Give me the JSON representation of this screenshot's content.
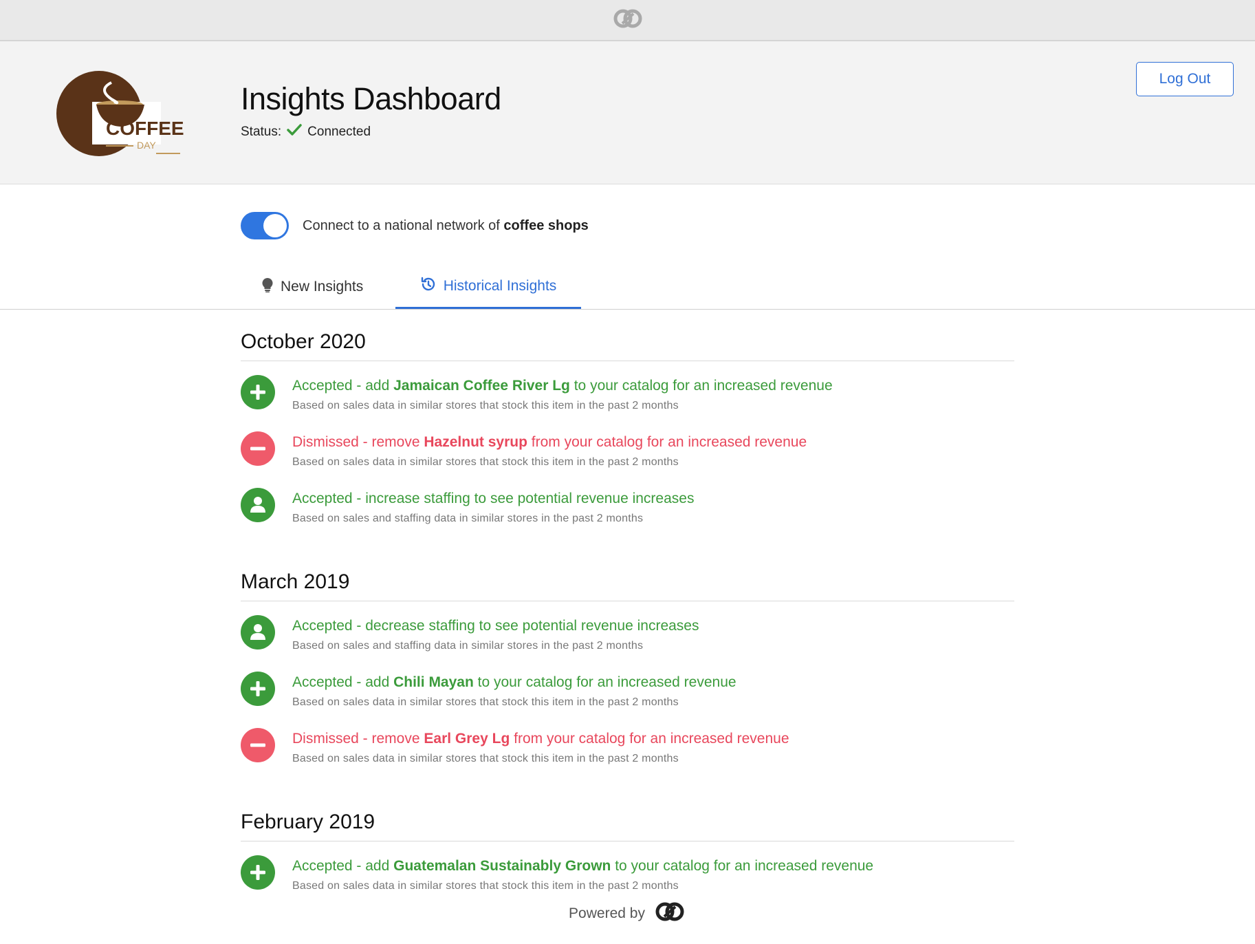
{
  "colors": {
    "accent": "#2f6fd6",
    "accepted": "#3b9b3b",
    "dismissed": "#e8475c"
  },
  "logo": {
    "line1": "COFFEE",
    "line2": "DAY"
  },
  "header": {
    "title": "Insights Dashboard",
    "status_label": "Status:",
    "status_value": "Connected",
    "logout_label": "Log Out"
  },
  "toggle": {
    "label_prefix": "Connect to a national network of",
    "label_bold": "coffee shops",
    "state": "on"
  },
  "tabs": {
    "new": "New Insights",
    "historical": "Historical Insights"
  },
  "sections": [
    {
      "month": "October 2020",
      "items": [
        {
          "status": "accepted",
          "icon": "plus-icon",
          "prefix": "Accepted - add",
          "bold": "Jamaican Coffee River Lg",
          "suffix": "to your catalog for an increased revenue",
          "sub": "Based on sales data in similar stores that stock this item in the past 2 months"
        },
        {
          "status": "dismissed",
          "icon": "minus-icon",
          "prefix": "Dismissed - remove",
          "bold": "Hazelnut syrup",
          "suffix": "from your catalog for an increased revenue",
          "sub": "Based on sales data in similar stores that stock this item in the past 2 months"
        },
        {
          "status": "accepted",
          "icon": "person-icon",
          "prefix": "Accepted - increase staffing to see potential revenue increases",
          "bold": "",
          "suffix": "",
          "sub": "Based on sales and staffing data in similar stores in the past 2 months"
        }
      ]
    },
    {
      "month": "March 2019",
      "items": [
        {
          "status": "accepted",
          "icon": "person-icon",
          "prefix": "Accepted - decrease staffing to see potential revenue increases",
          "bold": "",
          "suffix": "",
          "sub": "Based on sales and staffing data in similar stores in the past 2 months"
        },
        {
          "status": "accepted",
          "icon": "plus-icon",
          "prefix": "Accepted - add",
          "bold": "Chili Mayan",
          "suffix": "to your catalog for an increased revenue",
          "sub": "Based on sales data in similar stores that stock this item in the past 2 months"
        },
        {
          "status": "dismissed",
          "icon": "minus-icon",
          "prefix": "Dismissed - remove",
          "bold": "Earl Grey Lg",
          "suffix": "from your catalog for an increased revenue",
          "sub": "Based on sales data in similar stores that stock this item in the past 2 months"
        }
      ]
    },
    {
      "month": "February 2019",
      "items": [
        {
          "status": "accepted",
          "icon": "plus-icon",
          "prefix": "Accepted - add",
          "bold": "Guatemalan Sustainably Grown",
          "suffix": "to your catalog for an increased revenue",
          "sub": "Based on sales data in similar stores that stock this item in the past 2 months"
        }
      ]
    }
  ],
  "footer": {
    "powered_by": "Powered by"
  }
}
